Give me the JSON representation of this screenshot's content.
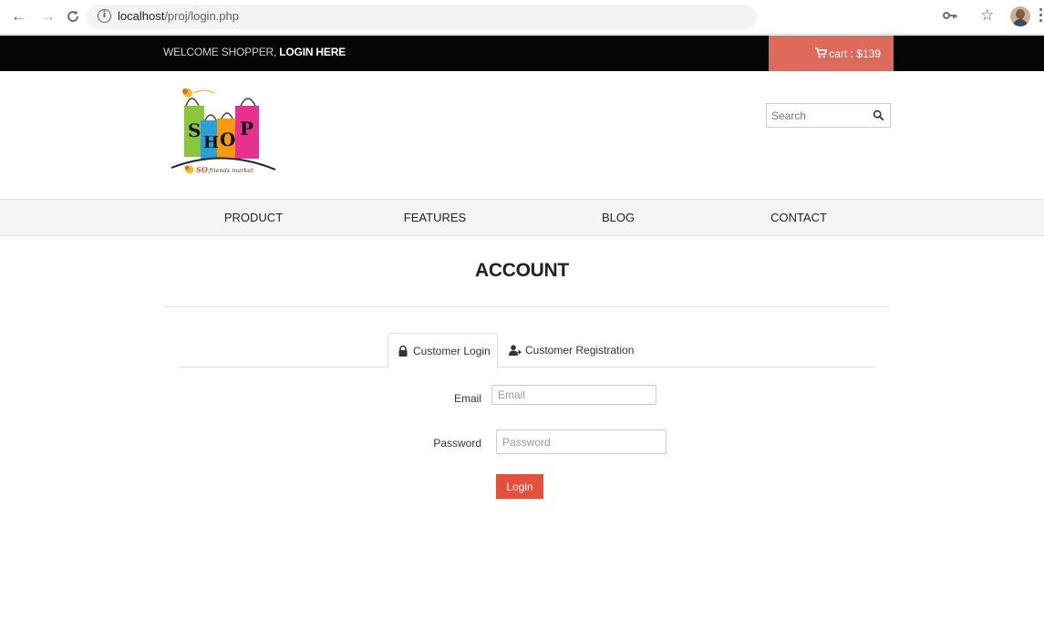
{
  "browser": {
    "url_host": "localhost",
    "url_path": "/proj/login.php"
  },
  "topbar": {
    "welcome_text": "WELCOME SHOPPER, ",
    "login_link": "LOGIN HERE",
    "cart_label": "cart : $139"
  },
  "logo": {
    "big_letters": [
      "S",
      "H",
      "O",
      "P"
    ],
    "tagline": "friends market"
  },
  "search": {
    "placeholder": "Search"
  },
  "nav": {
    "items": [
      "PRODUCT",
      "FEATURES",
      "BLOG",
      "CONTACT"
    ]
  },
  "account": {
    "title": "ACCOUNT"
  },
  "tabs": {
    "login": "Customer Login",
    "registration": "Customer Registration"
  },
  "form": {
    "email_label": "Email",
    "email_placeholder": "Email",
    "password_label": "Password",
    "password_placeholder": "Password",
    "submit_label": "Login"
  },
  "colors": {
    "topbar_bg": "#050505",
    "cart_bg": "#de6a5b",
    "login_button": "#e4503d",
    "nav_bg": "#f5f5f5"
  },
  "icons": {
    "browser": [
      "back-arrow-icon",
      "forward-arrow-icon",
      "reload-icon",
      "info-icon",
      "key-icon",
      "star-icon",
      "menu-kebab-icon"
    ],
    "cart": "shopping-cart-icon",
    "search": "search-icon",
    "login_tab": "lock-icon",
    "registration_tab": "user-plus-icon"
  }
}
